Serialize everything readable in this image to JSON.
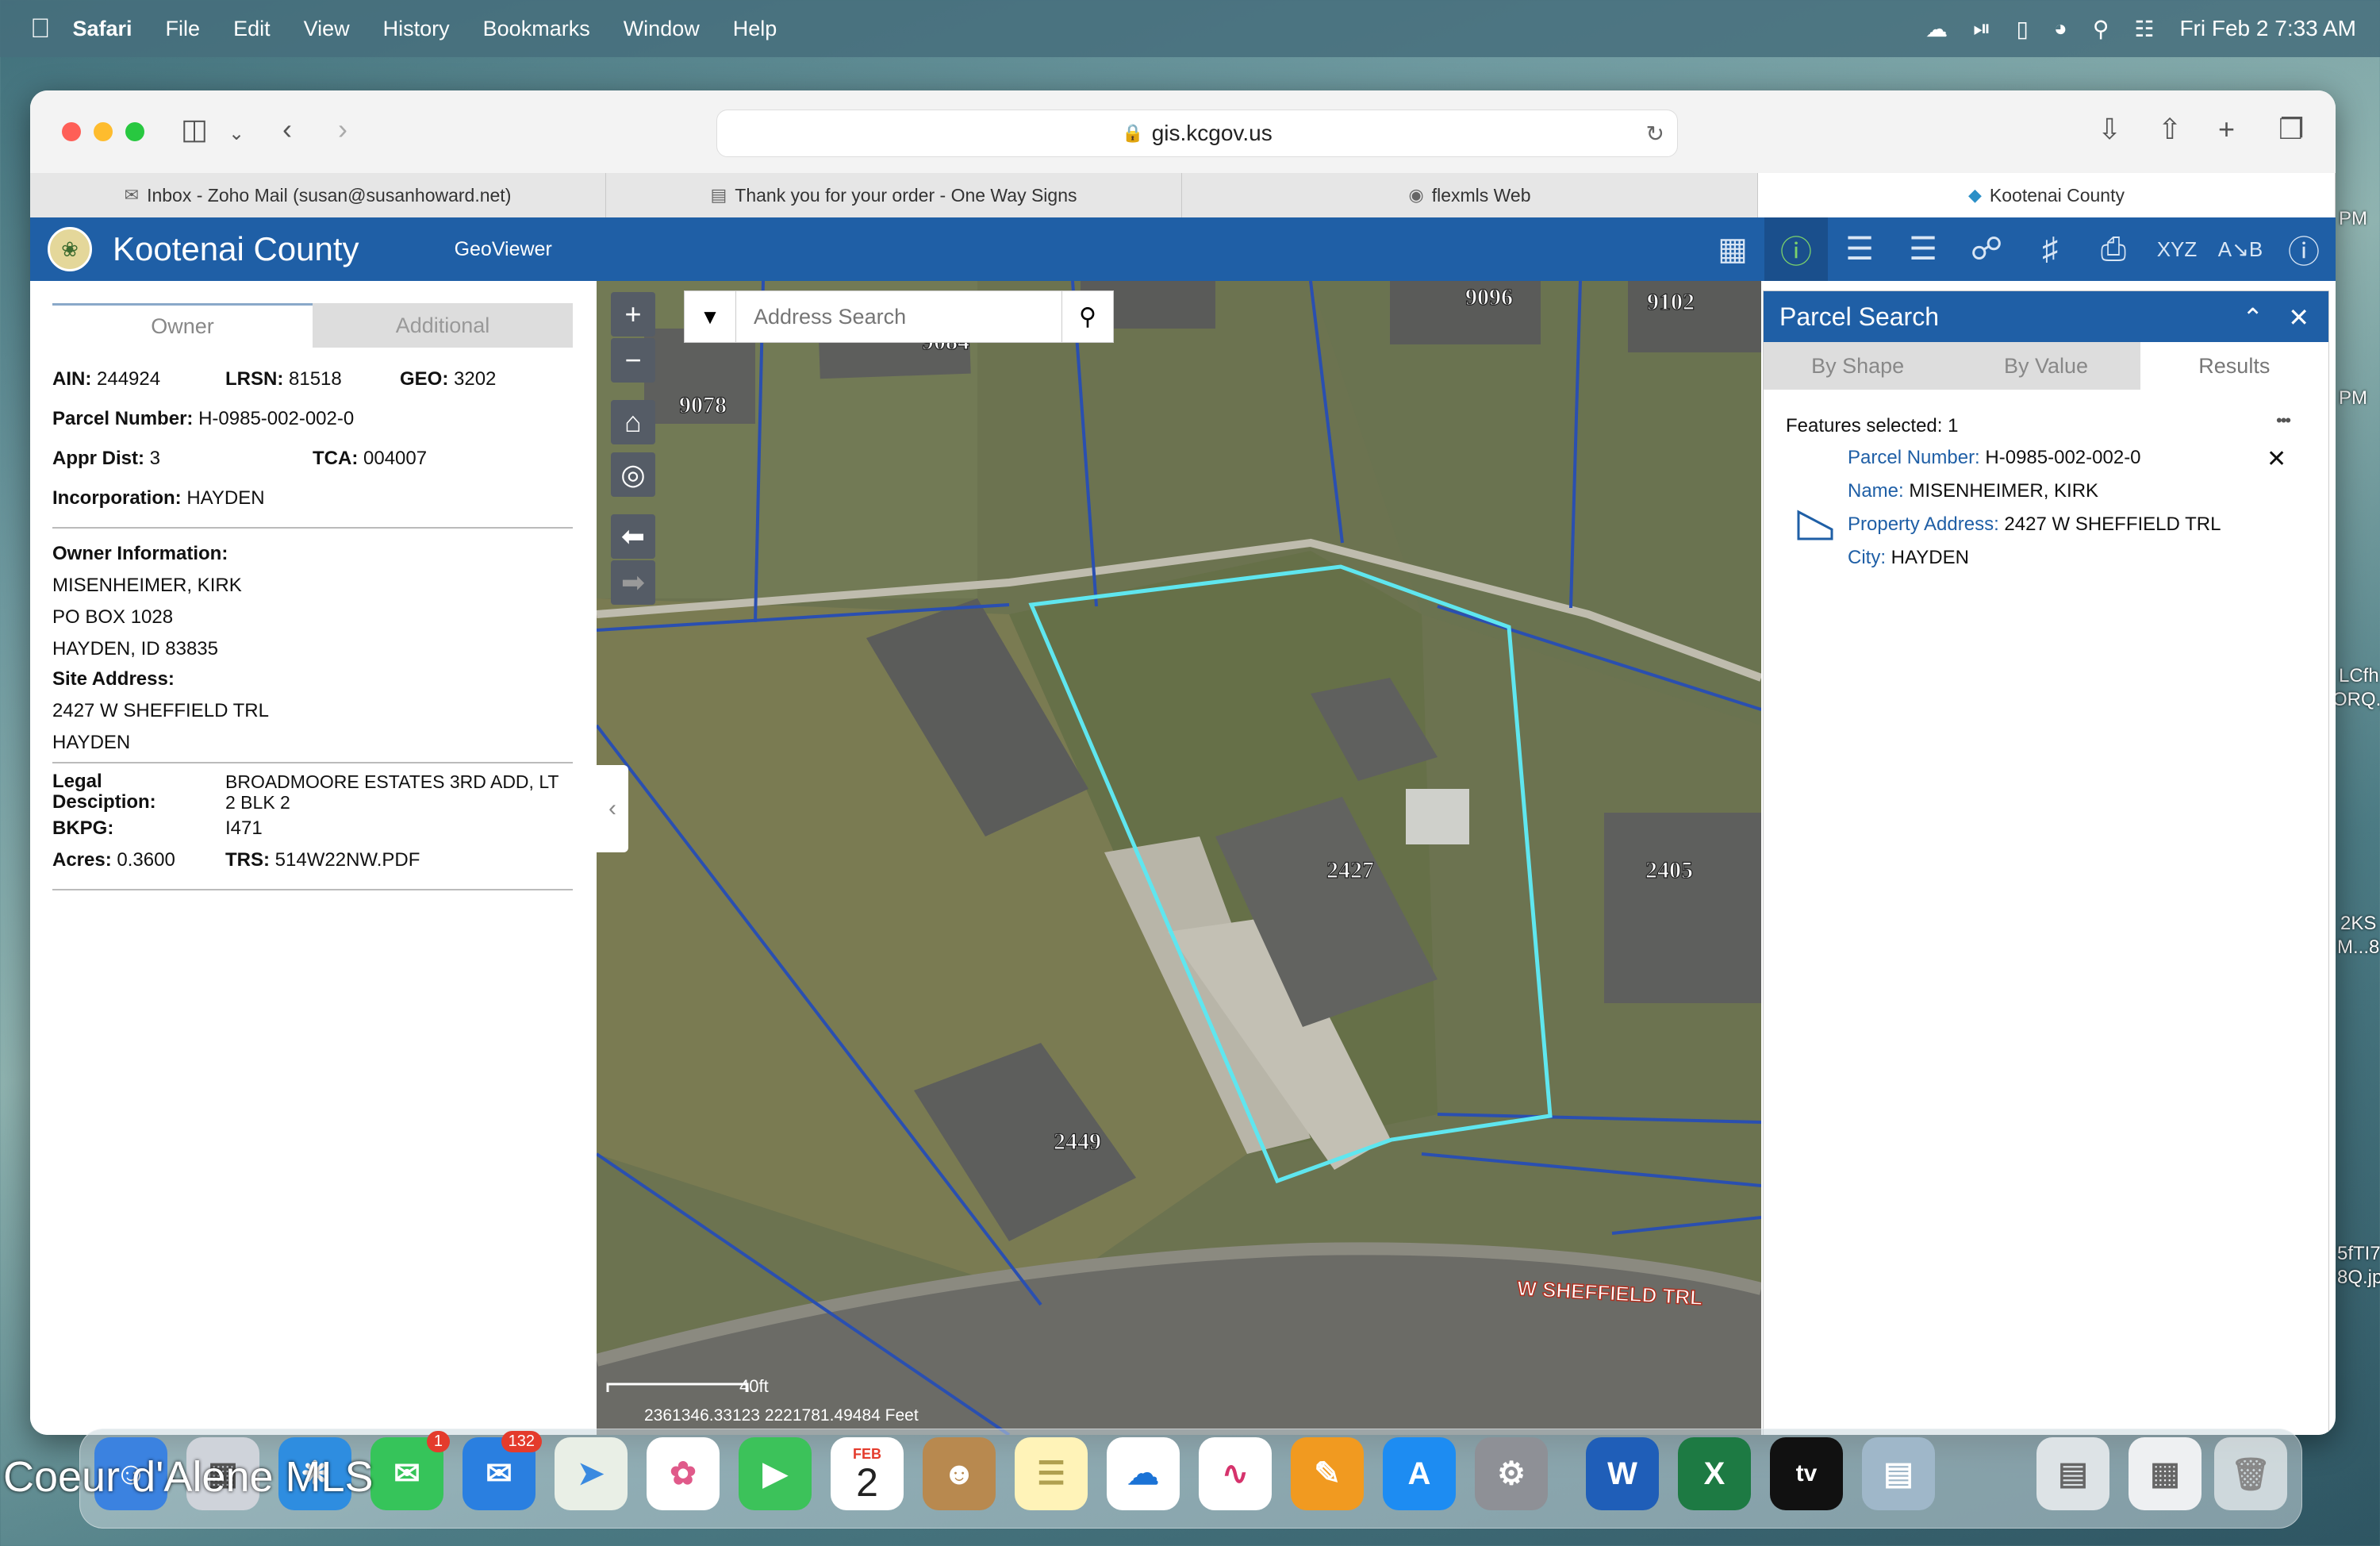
{
  "menubar": {
    "app": "Safari",
    "items": [
      "File",
      "Edit",
      "View",
      "History",
      "Bookmarks",
      "Window",
      "Help"
    ],
    "datetime": "Fri Feb 2  7:33 AM"
  },
  "desktop_right_text": [
    "PM",
    "PM",
    "LCfh",
    "ORQ.j",
    "2KS",
    "M...8",
    "5fTI7",
    "8Q.jp"
  ],
  "browser": {
    "url": "gis.kcgov.us",
    "tabs": [
      {
        "label": "Inbox - Zoho Mail (susan@susanhoward.net)",
        "icon": "mail-icon"
      },
      {
        "label": "Thank you for your order - One Way Signs",
        "icon": "doc-icon"
      },
      {
        "label": "flexmls Web",
        "icon": "flexmls-icon"
      },
      {
        "label": "Kootenai County",
        "icon": "kc-icon"
      }
    ]
  },
  "app": {
    "title": "Kootenai County",
    "subtitle": "GeoViewer"
  },
  "owner_panel": {
    "tabs": [
      "Owner",
      "Additional"
    ],
    "ain_label": "AIN:",
    "ain": "244924",
    "lrsn_label": "LRSN:",
    "lrsn": "81518",
    "geo_label": "GEO:",
    "geo": "3202",
    "parcel_label": "Parcel Number:",
    "parcel": "H-0985-002-002-0",
    "appr_label": "Appr Dist:",
    "appr": "3",
    "tca_label": "TCA:",
    "tca": "004007",
    "inc_label": "Incorporation:",
    "inc": "HAYDEN",
    "owner_label": "Owner Information:",
    "owner_lines": [
      "MISENHEIMER, KIRK",
      "PO BOX 1028",
      "HAYDEN,  ID 83835"
    ],
    "site_label": "Site Address:",
    "site_lines": [
      "2427 W SHEFFIELD TRL",
      "HAYDEN"
    ],
    "legal_label_1": "Legal",
    "legal_label_2": "Desciption:",
    "legal_1": "BROADMOORE ESTATES 3RD ADD, LT",
    "legal_2": "2 BLK 2",
    "bkpg_label": "BKPG:",
    "bkpg": "I471",
    "acres_label": "Acres:",
    "acres": "0.3600",
    "trs_label": "TRS:",
    "trs": "514W22NW.PDF"
  },
  "map": {
    "search_placeholder": "Address Search",
    "labels": [
      "9096",
      "9102",
      "9084",
      "9078",
      "2427",
      "2405",
      "2449"
    ],
    "street": "W SHEFFIELD TRL",
    "scale": "40ft",
    "coords": "2361346.33123 2221781.49484 Feet"
  },
  "parcel_search": {
    "title": "Parcel Search",
    "tabs": [
      "By Shape",
      "By Value",
      "Results"
    ],
    "features_selected": "Features selected: 1",
    "more": "•••",
    "result": {
      "parcel_key": "Parcel Number:",
      "parcel_val": " H-0985-002-002-0",
      "name_key": "Name:",
      "name_val": " MISENHEIMER, KIRK",
      "addr_key": "Property Address:",
      "addr_val": " 2427 W SHEFFIELD TRL",
      "city_key": "City:",
      "city_val": " HAYDEN"
    }
  },
  "dock": {
    "watermark": "Coeur d'Alene MLS",
    "messages_badge": "1",
    "mail_badge": "132",
    "calendar_month": "FEB",
    "calendar_day": "2",
    "tv_label": "tv"
  }
}
